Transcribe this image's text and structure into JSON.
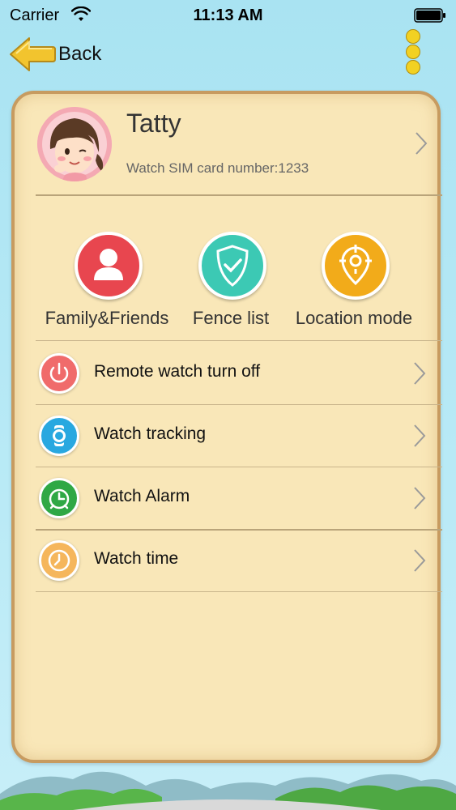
{
  "status_bar": {
    "carrier": "Carrier",
    "time": "11:13 AM",
    "wifi_icon": "wifi-icon",
    "battery_icon": "battery-icon"
  },
  "nav": {
    "back_label": "Back",
    "back_icon": "back-arrow-icon",
    "more_icon": "more-vertical-icon"
  },
  "profile": {
    "name": "Tatty",
    "sim_text": "Watch SIM card number:1233",
    "avatar_icon": "girl-avatar"
  },
  "quick_actions": [
    {
      "label": "Family&Friends",
      "icon": "person-icon",
      "color": "#e8464f"
    },
    {
      "label": "Fence list",
      "icon": "shield-check-icon",
      "color": "#3cc9b4"
    },
    {
      "label": "Location mode",
      "icon": "location-target-icon",
      "color": "#f2ab1a"
    }
  ],
  "menu": [
    {
      "label": "Remote watch turn off",
      "icon": "power-icon",
      "color": "#f06b6b"
    },
    {
      "label": "Watch tracking",
      "icon": "watch-icon",
      "color": "#29a8e0"
    },
    {
      "label": "Watch Alarm",
      "icon": "alarm-clock-icon",
      "color": "#2fa845"
    },
    {
      "label": "Watch time",
      "icon": "clock-icon",
      "color": "#f5b65c"
    }
  ],
  "colors": {
    "card_bg": "#f9e7b8",
    "card_border": "#c79b60",
    "sky": "#b9eaf6",
    "back_arrow": "#f2c42e"
  }
}
